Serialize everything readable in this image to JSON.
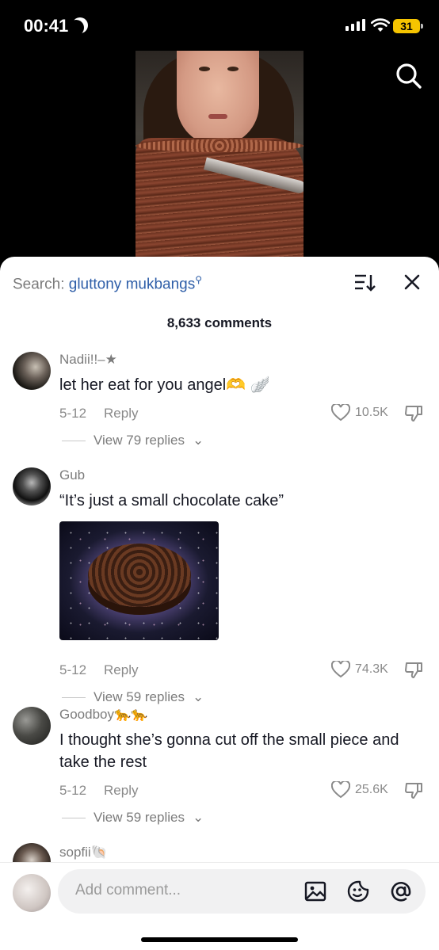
{
  "status_bar": {
    "time": "00:41",
    "battery": "31"
  },
  "search": {
    "prefix": "Search: ",
    "query": "gluttony mukbangs"
  },
  "comment_count": "8,633 comments",
  "comments": [
    {
      "username": "Nadii!!–★",
      "text": "let her eat for you angel🫶 🪽",
      "date": "5-12",
      "reply": "Reply",
      "likes": "10.5K",
      "replies": "View 79 replies"
    },
    {
      "username": "Gub",
      "text": "“It’s just a small chocolate cake”",
      "date": "5-12",
      "reply": "Reply",
      "likes": "74.3K",
      "replies": "View 59 replies"
    },
    {
      "username": "Goodboy🐆🐆",
      "text": "I thought she’s gonna cut off the small piece and take the rest",
      "date": "5-12",
      "reply": "Reply",
      "likes": "25.6K",
      "replies": "View 59 replies"
    },
    {
      "username": "sopfii🐚"
    }
  ],
  "composer": {
    "placeholder": "Add comment..."
  },
  "colors": {
    "query": "#2e5ea8",
    "muted": "#8a8a8a",
    "text": "#161823"
  }
}
